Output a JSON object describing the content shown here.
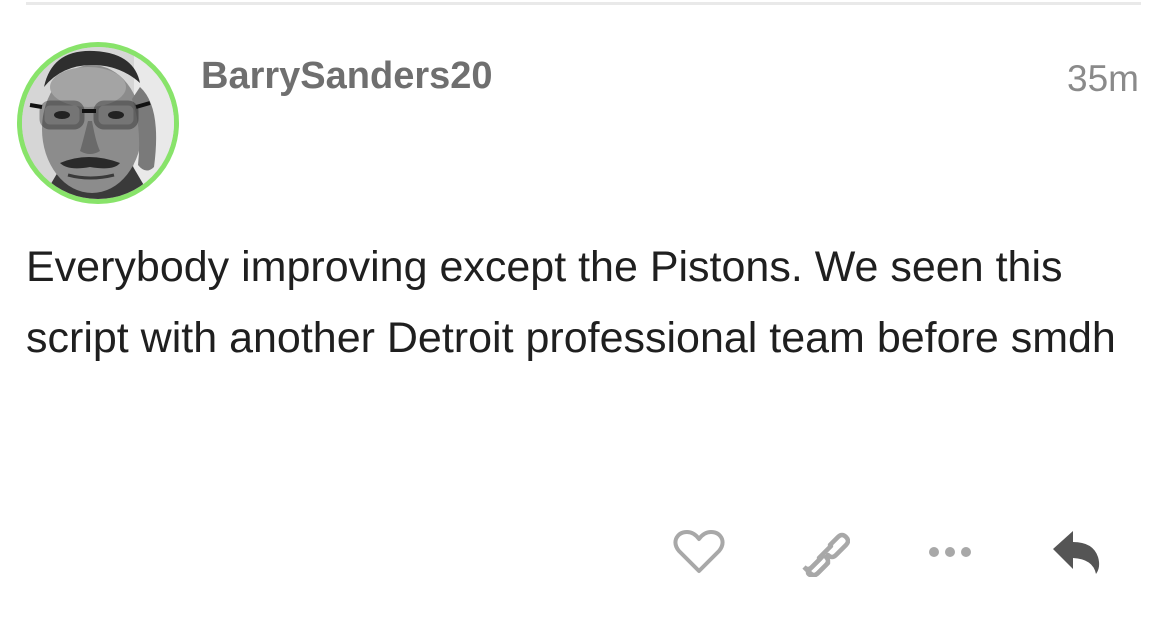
{
  "post": {
    "username": "BarrySanders20",
    "timestamp": "35m",
    "body": "Everybody improving except the Pistons. We seen this script with another Detroit professional team before smdh"
  },
  "avatar": {
    "ring_color": "#88e36a"
  },
  "actions": [
    {
      "name": "like",
      "icon": "heart-icon"
    },
    {
      "name": "copy-link",
      "icon": "link-icon"
    },
    {
      "name": "more",
      "icon": "ellipsis-icon"
    },
    {
      "name": "reply",
      "icon": "reply-arrow-icon"
    }
  ],
  "colors": {
    "username": "#6f6f6f",
    "timestamp": "#8a8a8a",
    "body_text": "#1f1f1f",
    "icon_gray": "#a8a8a8",
    "reply_icon": "#555555"
  }
}
